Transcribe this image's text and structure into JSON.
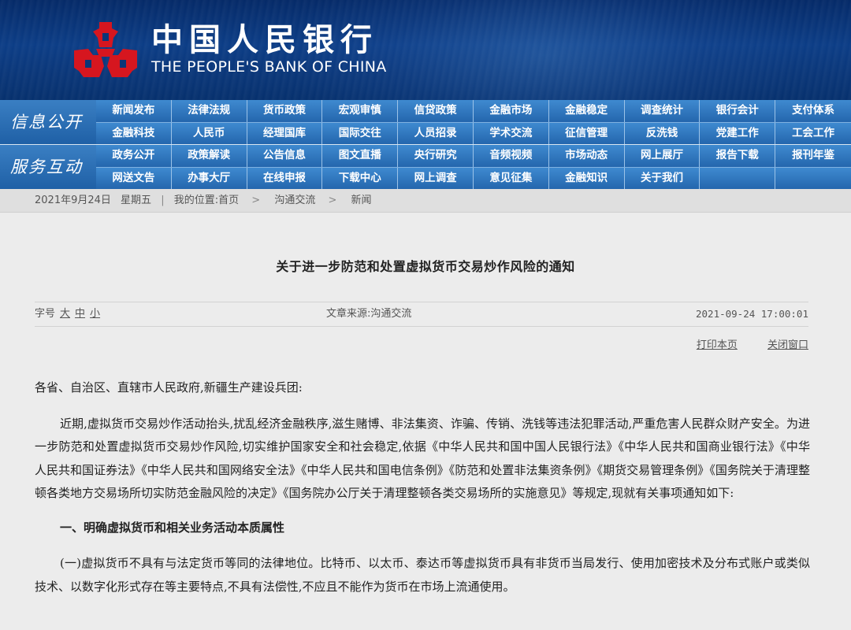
{
  "brand": {
    "name_cn": "中国人民银行",
    "name_en": "THE PEOPLE'S BANK OF CHINA",
    "logo_color": "#d6161f"
  },
  "nav": {
    "info_label": "信息公开",
    "info_row1": [
      "新闻发布",
      "法律法规",
      "货币政策",
      "宏观审慎",
      "信贷政策",
      "金融市场",
      "金融稳定",
      "调查统计",
      "银行会计",
      "支付体系"
    ],
    "info_row2": [
      "金融科技",
      "人民币",
      "经理国库",
      "国际交往",
      "人员招录",
      "学术交流",
      "征信管理",
      "反洗钱",
      "党建工作",
      "工会工作"
    ],
    "service_label": "服务互动",
    "service_row1": [
      "政务公开",
      "政策解读",
      "公告信息",
      "图文直播",
      "央行研究",
      "音频视频",
      "市场动态",
      "网上展厅",
      "报告下载",
      "报刊年鉴"
    ],
    "service_row2": [
      "网送文告",
      "办事大厅",
      "在线申报",
      "下载中心",
      "网上调查",
      "意见征集",
      "金融知识",
      "关于我们"
    ]
  },
  "breadcrumb": {
    "date": "2021年9月24日",
    "weekday": "星期五",
    "location_label": "我的位置:",
    "home": "首页",
    "level1": "沟通交流",
    "level2": "新闻",
    "arrow": ">",
    "divider": "|"
  },
  "article": {
    "title": "关于进一步防范和处置虚拟货币交易炒作风险的通知",
    "font_size_label": "字号",
    "font_large": "大",
    "font_medium": "中",
    "font_small": "小",
    "source": "文章来源:沟通交流",
    "datetime": "2021-09-24 17:00:01",
    "print": "打印本页",
    "close": "关闭窗口",
    "greeting": "各省、自治区、直辖市人民政府,新疆生产建设兵团:",
    "para1": "近期,虚拟货币交易炒作活动抬头,扰乱经济金融秩序,滋生赌博、非法集资、诈骗、传销、洗钱等违法犯罪活动,严重危害人民群众财产安全。为进一步防范和处置虚拟货币交易炒作风险,切实维护国家安全和社会稳定,依据《中华人民共和国中国人民银行法》《中华人民共和国商业银行法》《中华人民共和国证券法》《中华人民共和国网络安全法》《中华人民共和国电信条例》《防范和处置非法集资条例》《期货交易管理条例》《国务院关于清理整顿各类地方交易场所切实防范金融风险的决定》《国务院办公厅关于清理整顿各类交易场所的实施意见》等规定,现就有关事项通知如下:",
    "section1": "一、明确虚拟货币和相关业务活动本质属性",
    "para2": "(一)虚拟货币不具有与法定货币等同的法律地位。比特币、以太币、泰达币等虚拟货币具有非货币当局发行、使用加密技术及分布式账户或类似技术、以数字化形式存在等主要特点,不具有法偿性,不应且不能作为货币在市场上流通使用。"
  }
}
